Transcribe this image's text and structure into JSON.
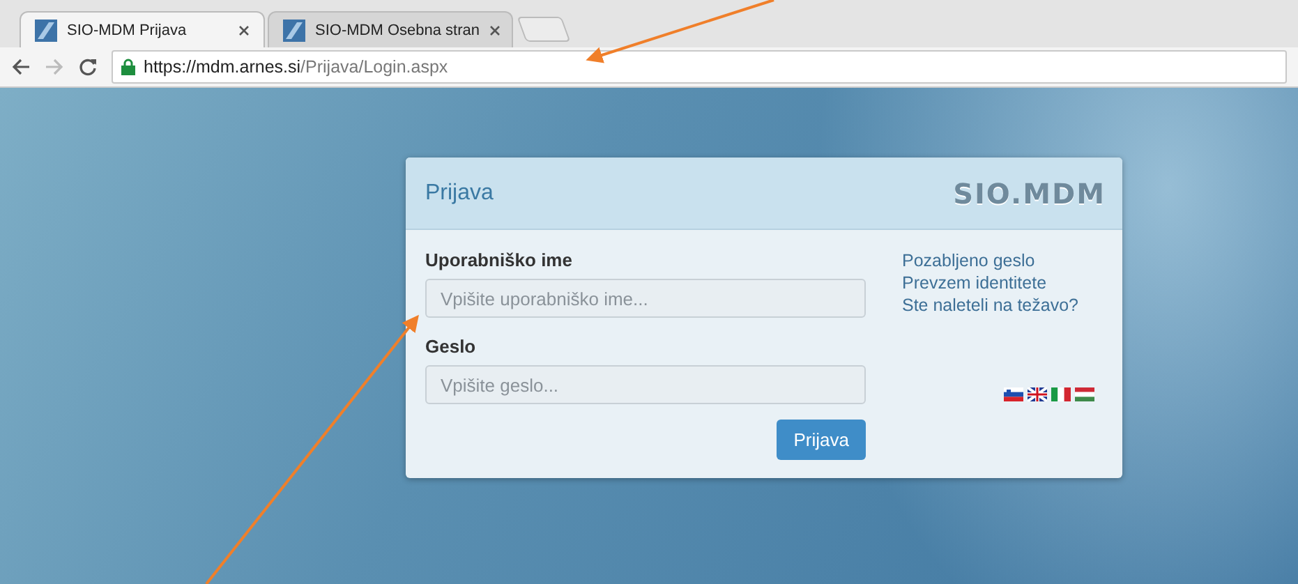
{
  "tabs": [
    {
      "title": "SIO-MDM Prijava",
      "selected": true
    },
    {
      "title": "SIO-MDM Osebna stran",
      "selected": false
    }
  ],
  "address_bar": {
    "host": "https://mdm.arnes.si",
    "path": "/Prijava/Login.aspx"
  },
  "login": {
    "title": "Prijava",
    "logo": "SIO.MDM",
    "fields": [
      {
        "label": "Uporabniško ime",
        "placeholder": "Vpišite uporabniško ime..."
      },
      {
        "label": "Geslo",
        "placeholder": "Vpišite geslo..."
      }
    ],
    "submit": "Prijava",
    "links": [
      "Pozabljeno geslo",
      "Prevzem identitete",
      "Ste naleteli na težavo?"
    ],
    "languages": [
      {
        "kind": "slovenia"
      },
      {
        "kind": "uk"
      },
      {
        "kind": "italy"
      },
      {
        "kind": "hungary"
      }
    ]
  }
}
